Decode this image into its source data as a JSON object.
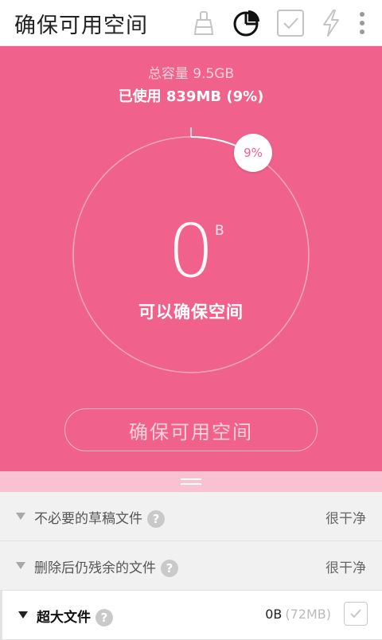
{
  "app": {
    "title": "确保可用空间"
  },
  "toolbar": {
    "icons": [
      "brush-icon",
      "pie-chart-icon",
      "checkbox-icon",
      "flash-icon",
      "more-icon"
    ],
    "active_icon": "pie-chart-icon"
  },
  "storage": {
    "total_label": "总容量 9.5GB",
    "used_label": "已使用 839MB (9%)",
    "percent_badge": "9%",
    "percent_used": 9,
    "free_value": "0",
    "free_unit": "B",
    "circle_label": "可以确保空间",
    "action_label": "确保可用空间"
  },
  "colors": {
    "accent": "#f0628c"
  },
  "categories": [
    {
      "label": "不必要的草稿文件",
      "status": "很干净",
      "expanded": false
    },
    {
      "label": "删除后仍残余的文件",
      "status": "很干净",
      "expanded": false
    },
    {
      "label": "超大文件",
      "size": "0B",
      "total": "(72MB)",
      "expanded": true
    }
  ]
}
